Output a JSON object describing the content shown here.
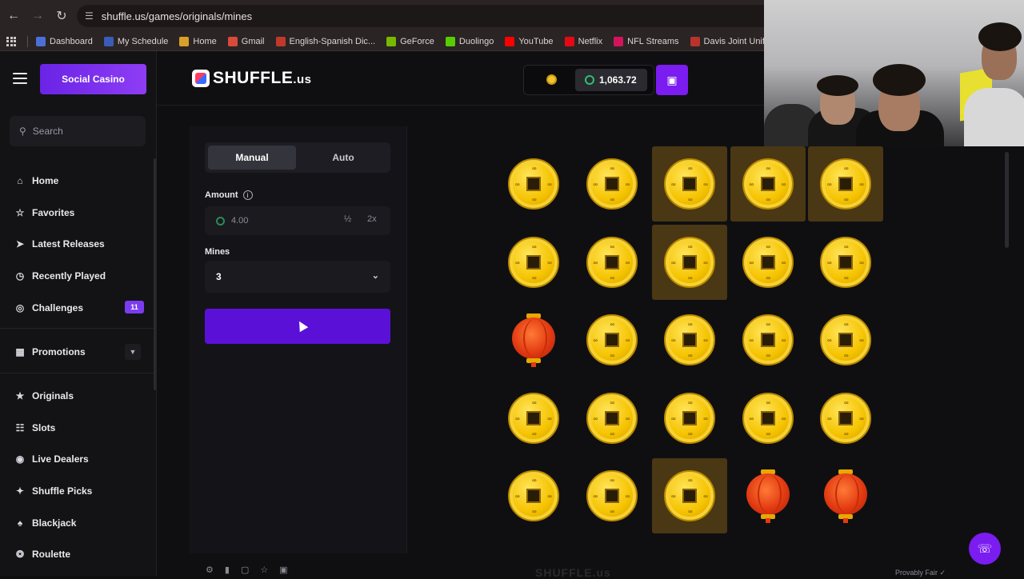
{
  "browser": {
    "url": "shuffle.us/games/originals/mines",
    "bookmarks": [
      {
        "label": "Dashboard",
        "color": "#4a6fd8"
      },
      {
        "label": "My Schedule",
        "color": "#3b5bb8"
      },
      {
        "label": "Home",
        "color": "#d8a02a"
      },
      {
        "label": "Gmail",
        "color": "#d84a3a"
      },
      {
        "label": "English-Spanish Dic...",
        "color": "#c0392b"
      },
      {
        "label": "GeForce",
        "color": "#76b900"
      },
      {
        "label": "Duolingo",
        "color": "#58cc02"
      },
      {
        "label": "YouTube",
        "color": "#ff0000"
      },
      {
        "label": "Netflix",
        "color": "#e50914"
      },
      {
        "label": "NFL Streams",
        "color": "#d4145a"
      },
      {
        "label": "Davis Joint Unified...",
        "color": "#b8332a"
      }
    ]
  },
  "sidebar": {
    "social_casino": "Social Casino",
    "search_placeholder": "Search",
    "items": [
      {
        "label": "Home",
        "icon": "home-icon"
      },
      {
        "label": "Favorites",
        "icon": "star-icon"
      },
      {
        "label": "Latest Releases",
        "icon": "rocket-icon"
      },
      {
        "label": "Recently Played",
        "icon": "clock-icon"
      },
      {
        "label": "Challenges",
        "icon": "target-icon",
        "badge": "11"
      },
      {
        "label": "Promotions",
        "icon": "gift-icon"
      },
      {
        "label": "Originals",
        "icon": "originals-icon"
      },
      {
        "label": "Slots",
        "icon": "slots-icon"
      },
      {
        "label": "Live Dealers",
        "icon": "live-icon"
      },
      {
        "label": "Shuffle Picks",
        "icon": "picks-icon"
      },
      {
        "label": "Blackjack",
        "icon": "cards-icon"
      },
      {
        "label": "Roulette",
        "icon": "roulette-icon"
      }
    ]
  },
  "header": {
    "logo_main": "SHUFFLE",
    "logo_suffix": ".us",
    "balance": "1,063.72"
  },
  "panel": {
    "tabs": [
      "Manual",
      "Auto"
    ],
    "amount_label": "Amount",
    "amount_value": "4.00",
    "half_label": "½",
    "double_label": "2x",
    "mines_label": "Mines",
    "mines_value": "3"
  },
  "grid": {
    "rows": [
      [
        {
          "t": "coin",
          "r": false
        },
        {
          "t": "coin",
          "r": false
        },
        {
          "t": "coin",
          "r": true
        },
        {
          "t": "coin",
          "r": true
        },
        {
          "t": "coin",
          "r": true
        }
      ],
      [
        {
          "t": "coin",
          "r": false
        },
        {
          "t": "coin",
          "r": false
        },
        {
          "t": "coin",
          "r": true
        },
        {
          "t": "coin",
          "r": false
        },
        {
          "t": "coin",
          "r": false
        }
      ],
      [
        {
          "t": "lantern",
          "r": false
        },
        {
          "t": "coin",
          "r": false
        },
        {
          "t": "coin",
          "r": false
        },
        {
          "t": "coin",
          "r": false
        },
        {
          "t": "coin",
          "r": false
        }
      ],
      [
        {
          "t": "coin",
          "r": false
        },
        {
          "t": "coin",
          "r": false
        },
        {
          "t": "coin",
          "r": false
        },
        {
          "t": "coin",
          "r": false
        },
        {
          "t": "coin",
          "r": false
        }
      ],
      [
        {
          "t": "coin",
          "r": false
        },
        {
          "t": "coin",
          "r": false
        },
        {
          "t": "coin",
          "r": true
        },
        {
          "t": "lantern",
          "r": false
        },
        {
          "t": "lantern",
          "r": false
        }
      ]
    ]
  },
  "footer": {
    "watermark": "SHUFFLE.us",
    "provably_fair": "Provably Fair"
  }
}
